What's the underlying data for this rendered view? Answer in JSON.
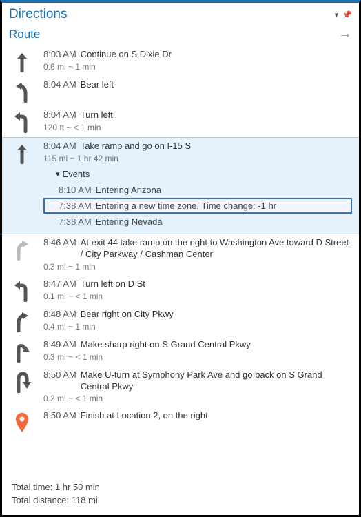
{
  "header": {
    "title": "Directions"
  },
  "route": {
    "label": "Route"
  },
  "steps": [
    {
      "time": "8:03 AM",
      "instr": "Continue on S Dixie Dr",
      "sub": "0.6 mi ~ 1 min",
      "icon": "straight"
    },
    {
      "time": "8:04 AM",
      "instr": "Bear left",
      "sub": "",
      "icon": "bear-left"
    },
    {
      "time": "8:04 AM",
      "instr": "Turn left",
      "sub": "120 ft ~ < 1 min",
      "icon": "turn-left"
    },
    {
      "time": "8:04 AM",
      "instr": "Take ramp and go on I-15 S",
      "sub": "115 mi ~ 1 hr 42 min",
      "icon": "straight",
      "highlighted": true,
      "events_label": "Events",
      "events": [
        {
          "time": "8:10 AM",
          "text": "Entering Arizona"
        },
        {
          "time": "7:38 AM",
          "text": "Entering a new time zone. Time change: -1 hr",
          "selected": true
        },
        {
          "time": "7:38 AM",
          "text": "Entering Nevada"
        }
      ]
    },
    {
      "time": "8:46 AM",
      "instr": "At exit 44 take ramp on the right to Washington Ave toward D Street / City Parkway / Cashman Center",
      "sub": "0.3 mi ~ 1 min",
      "icon": "bear-right-light"
    },
    {
      "time": "8:47 AM",
      "instr": "Turn left on D St",
      "sub": "0.1 mi ~ < 1 min",
      "icon": "turn-left"
    },
    {
      "time": "8:48 AM",
      "instr": "Bear right on City Pkwy",
      "sub": "0.4 mi ~ 1 min",
      "icon": "bear-right"
    },
    {
      "time": "8:49 AM",
      "instr": "Make sharp right on S Grand Central Pkwy",
      "sub": "0.3 mi ~ < 1 min",
      "icon": "sharp-right"
    },
    {
      "time": "8:50 AM",
      "instr": "Make U-turn at Symphony Park Ave and go back on S Grand Central Pkwy",
      "sub": "0.2 mi ~ < 1 min",
      "icon": "u-turn"
    },
    {
      "time": "8:50 AM",
      "instr": "Finish at Location 2, on the right",
      "sub": "",
      "icon": "pin"
    }
  ],
  "totals": {
    "time_label": "Total time:",
    "time_value": "1 hr 50 min",
    "dist_label": "Total distance:",
    "dist_value": "118 mi"
  }
}
